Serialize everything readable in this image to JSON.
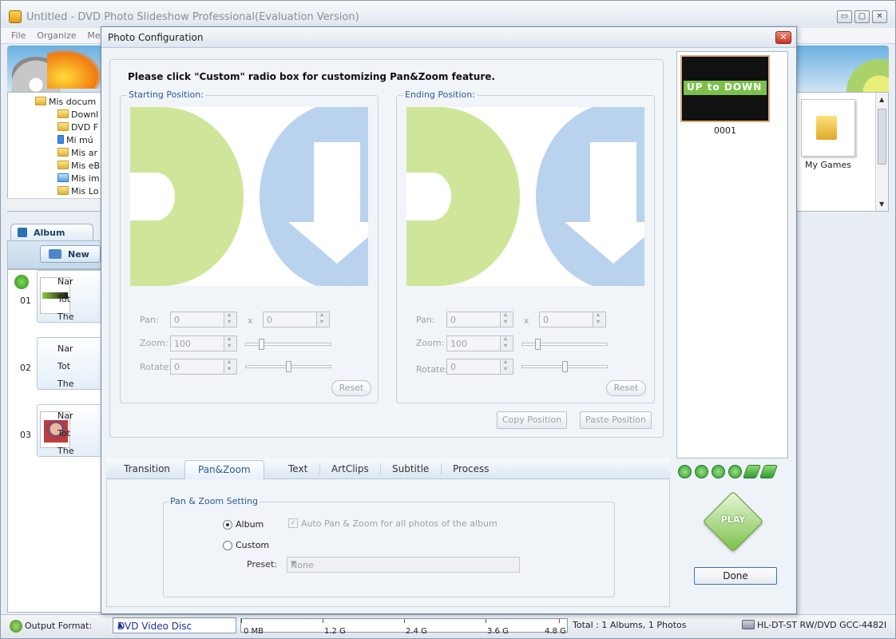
{
  "main": {
    "title": "Untitled - DVD Photo Slideshow Professional(Evaluation Version)",
    "menu": [
      "File",
      "Organize",
      "Menu"
    ],
    "tree": {
      "root": "Mis docum",
      "items": [
        "Downl",
        "DVD F",
        "Mi mú",
        "Mis ar",
        "Mis eB",
        "Mis im",
        "Mis Lo"
      ]
    },
    "files": [
      {
        "label": "My Games",
        "icon": "folder-icon"
      }
    ],
    "album_tab": "Album",
    "new_button": "New",
    "albums": [
      {
        "num": "01",
        "name": "Nar",
        "total": "Tot",
        "theme": "The"
      },
      {
        "num": "02",
        "name": "Nar",
        "total": "Tot",
        "theme": "The"
      },
      {
        "num": "03",
        "name": "Nar",
        "total": "Tot",
        "theme": "The"
      }
    ],
    "window_buttons": [
      "▭",
      "▢",
      "✕"
    ]
  },
  "status": {
    "output_label": "Output Format:",
    "output_value": "DVD Video Disc",
    "capacity_ticks": [
      "0 MB",
      "1.2 G",
      "2.4 G",
      "3.6 G",
      "4.8 G"
    ],
    "total": "Total : 1 Albums, 1 Photos",
    "drive": "HL-DT-ST RW/DVD GCC-4482I"
  },
  "dialog": {
    "title": "Photo Configuration",
    "close": "✕",
    "instruction": "Please click \"Custom\" radio box for customizing Pan&Zoom feature.",
    "starting": {
      "legend": "Starting Position:",
      "pan_label": "Pan:",
      "pan_x": "0",
      "pan_y": "0",
      "times": "x",
      "zoom_label": "Zoom:",
      "zoom": "100",
      "rotate_label": "Rotate:",
      "rotate": "0",
      "reset": "Reset"
    },
    "ending": {
      "legend": "Ending Position:",
      "pan_label": "Pan:",
      "pan_x": "0",
      "pan_y": "0",
      "times": "x",
      "zoom_label": "Zoom:",
      "zoom": "100",
      "rotate_label": "Rotate:",
      "rotate": "0",
      "reset": "Reset"
    },
    "copy_position": "Copy Position",
    "paste_position": "Paste Position",
    "thumbnail": {
      "caption": "0001",
      "text": "UP to DOWN"
    },
    "tabs": [
      "Transition",
      "Pan&Zoom",
      "Text",
      "ArtClips",
      "Subtitle",
      "Process"
    ],
    "active_tab": "Pan&Zoom",
    "pz": {
      "legend": "Pan & Zoom Setting",
      "album": "Album",
      "custom": "Custom",
      "auto": "Auto Pan & Zoom for all photos of the album",
      "preset_label": "Preset:",
      "preset_value": "None"
    },
    "play": "PLAY",
    "done": "Done",
    "colors": {
      "green": "#cfe69a",
      "blue": "#b9d2ee",
      "accent": "#2a5a9a"
    }
  }
}
